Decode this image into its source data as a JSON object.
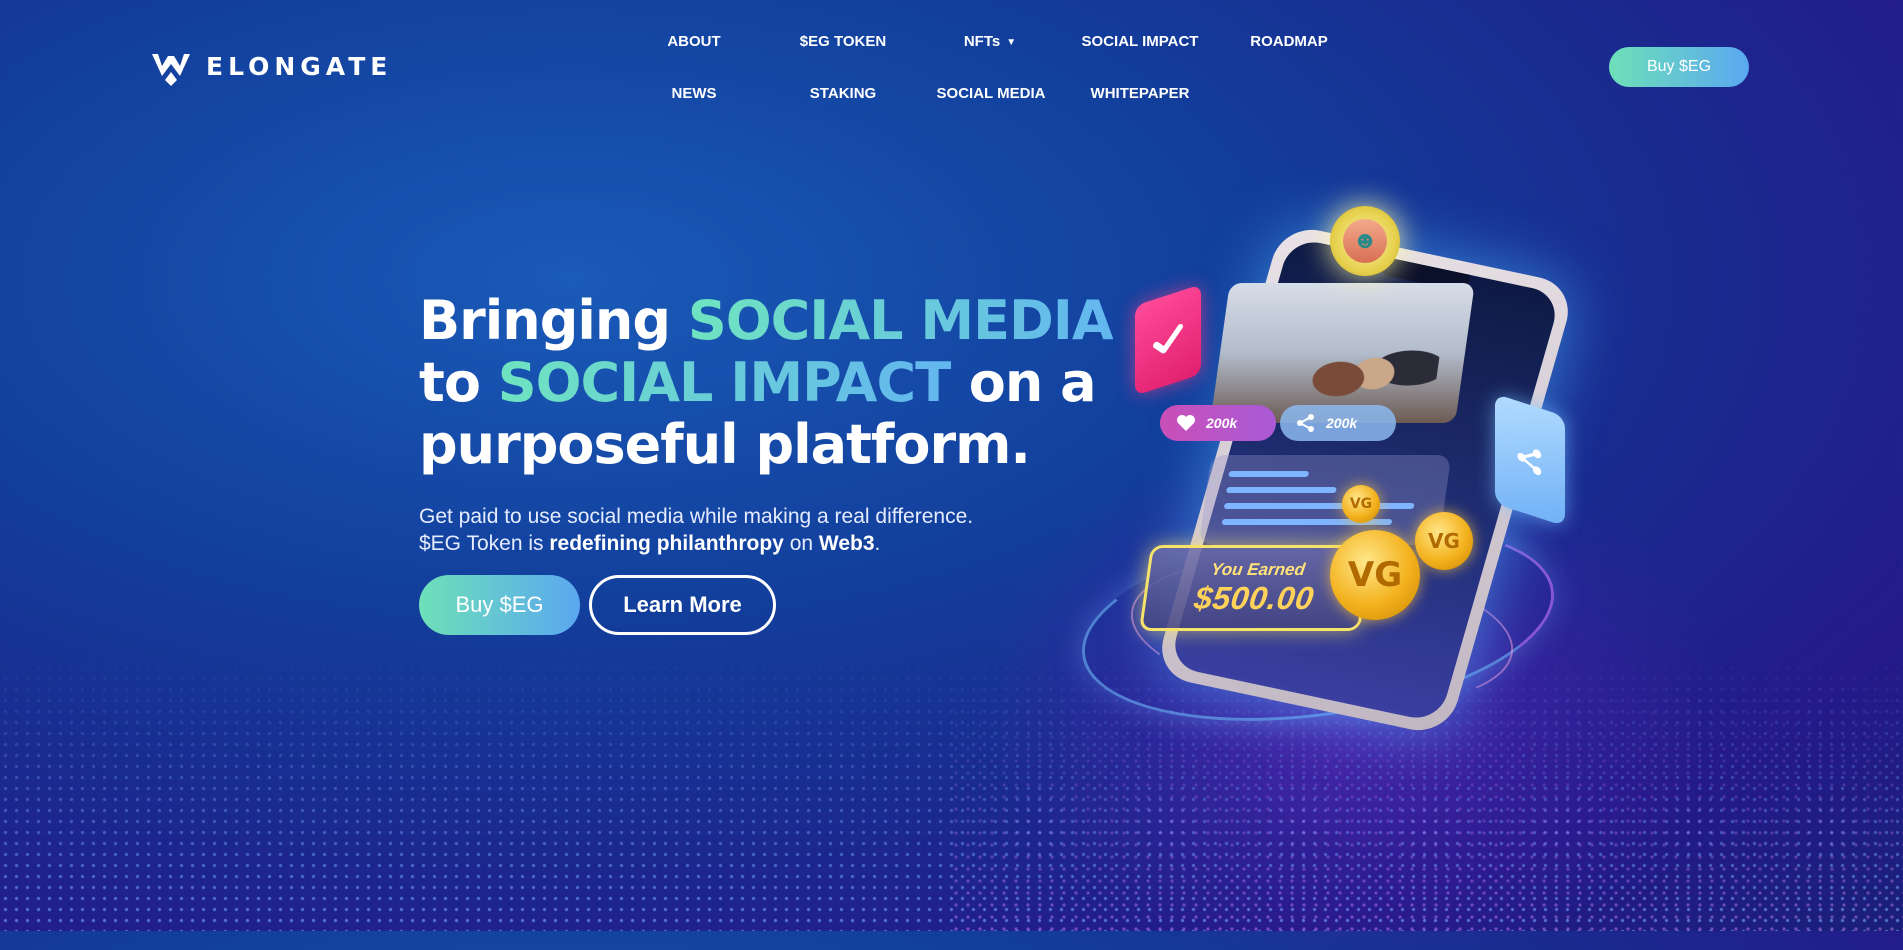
{
  "brand": {
    "name": "ELONGATE"
  },
  "nav": {
    "row1": [
      "ABOUT",
      "$EG TOKEN",
      "NFTs",
      "SOCIAL IMPACT",
      "ROADMAP"
    ],
    "row2": [
      "NEWS",
      "STAKING",
      "SOCIAL MEDIA",
      "WHITEPAPER"
    ],
    "nfts_has_dropdown": true
  },
  "header": {
    "buy_label": "Buy $EG"
  },
  "hero": {
    "headline": {
      "part1": "Bringing ",
      "accent1": "SOCIAL MEDIA",
      "part2": " to ",
      "accent2": "SOCIAL IMPACT",
      "part3": " on a purposeful platform."
    },
    "subtitle": {
      "line1": "Get paid to use social media while making a real difference.",
      "line2_prefix": "$EG Token is ",
      "line2_bold1": "redefining philanthropy",
      "line2_mid": " on ",
      "line2_bold2": "Web3",
      "line2_suffix": "."
    },
    "buy_label": "Buy $EG",
    "learn_label": "Learn More"
  },
  "illustration": {
    "likes": "200k",
    "shares": "200k",
    "earned_label": "You Earned",
    "earned_amount": "$500.00"
  },
  "colors": {
    "accent_gradient_start": "#6ee0b8",
    "accent_gradient_end": "#5aa8f0",
    "background_primary": "#123f9c",
    "background_secondary": "#241a8a"
  },
  "icons": [
    "elongate-logo-icon",
    "caret-down-icon",
    "heart-icon",
    "share-icon",
    "check-icon",
    "avatar-icon",
    "coin-icon"
  ]
}
